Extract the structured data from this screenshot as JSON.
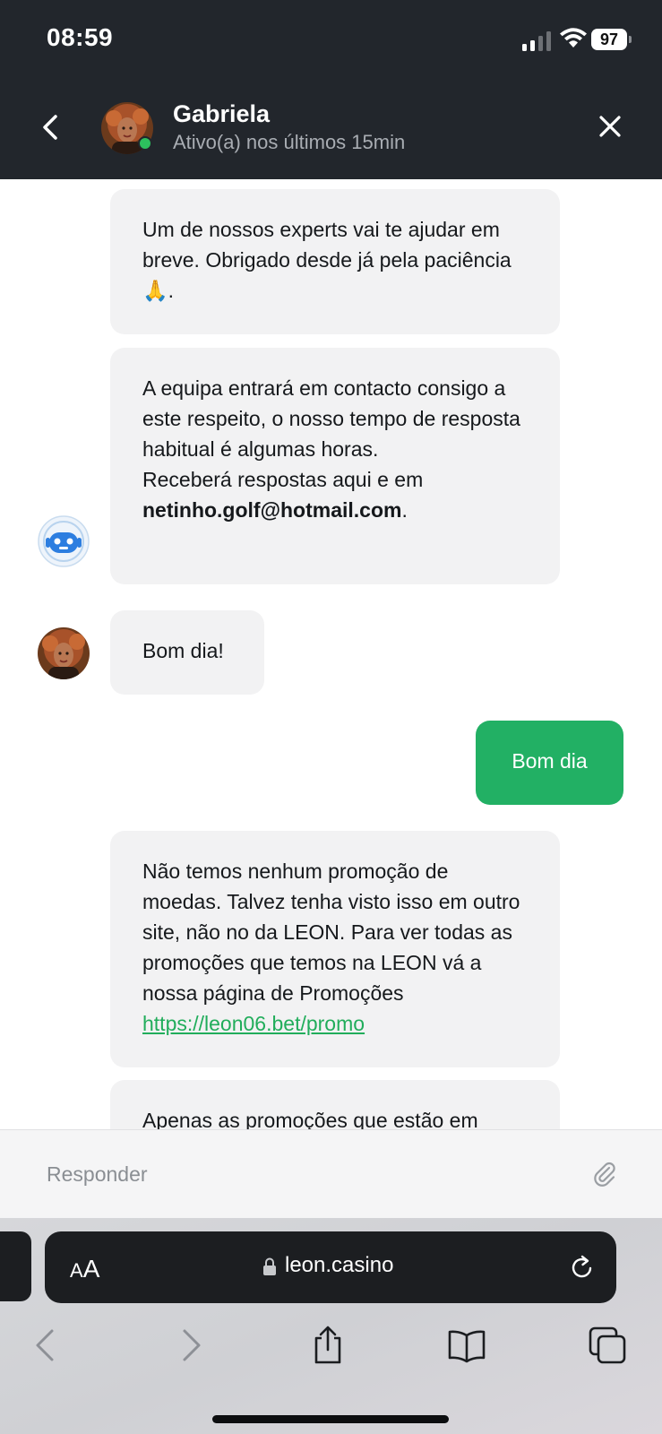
{
  "status_bar": {
    "time": "08:59",
    "battery": "97"
  },
  "header": {
    "back_icon": "chevron-left-icon",
    "name": "Gabriela",
    "status": "Ativo(a) nos últimos 15min",
    "close_icon": "close-icon"
  },
  "messages": {
    "m1": {
      "text": "Um de nossos experts vai te ajudar em breve. Obrigado desde já pela paciência 🙏."
    },
    "m2": {
      "text": "A equipa entrará em contacto consigo a este respeito, o nosso tempo de resposta habitual é algumas horas.",
      "text2": "Receberá respostas aqui e em",
      "email": "netinho.golf@hotmail.com",
      "suffix": "."
    },
    "m3": {
      "text": "Bom dia!"
    },
    "m4": {
      "text": "Bom dia"
    },
    "m5": {
      "text": "Não temos nenhum promoção de moedas. Talvez tenha visto isso em outro site, não no da LEON. Para ver todas as promoções que temos na LEON vá a nossa página de Promoções",
      "link": "https://leon06.bet/promo"
    },
    "m6": {
      "text": "Apenas as promoções que estão em"
    }
  },
  "reply": {
    "placeholder": "Responder",
    "attach_icon": "paperclip-icon"
  },
  "browser": {
    "aa_small": "A",
    "aa_big": "A",
    "url": "leon.casino",
    "icons": [
      "lock-icon",
      "reload-icon",
      "back-arrow-icon",
      "forward-arrow-icon",
      "share-icon",
      "bookmarks-icon",
      "tabs-icon"
    ]
  },
  "colors": {
    "header_bg": "#22262c",
    "accent_green": "#22b064",
    "link_green": "#21ad5b",
    "bubble_bg": "#f2f2f3"
  }
}
